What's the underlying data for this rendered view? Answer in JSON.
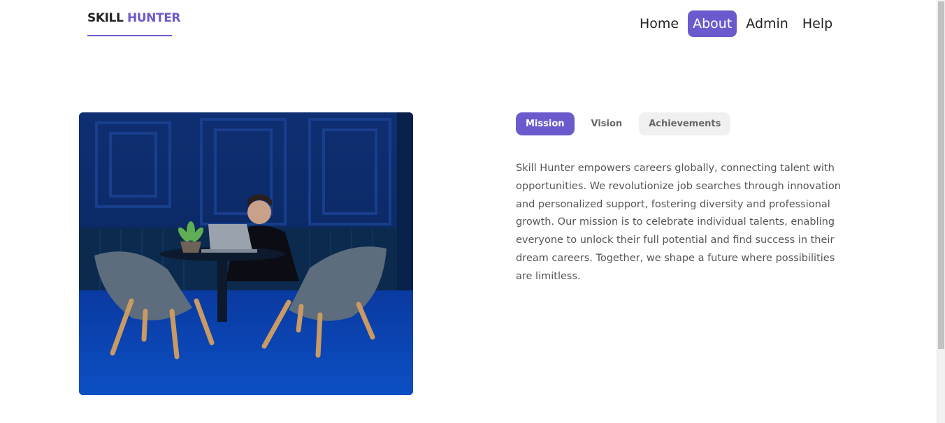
{
  "logo": {
    "skill": "SKILL",
    "hunter": "HUNTER"
  },
  "nav": {
    "items": [
      {
        "label": "Home"
      },
      {
        "label": "About"
      },
      {
        "label": "Admin"
      },
      {
        "label": "Help"
      }
    ],
    "active": "About"
  },
  "tabs": {
    "items": [
      {
        "label": "Mission"
      },
      {
        "label": "Vision"
      },
      {
        "label": "Achievements"
      }
    ],
    "active": "Mission"
  },
  "content": {
    "text": "Skill Hunter empowers careers globally, connecting talent with opportunities. We revolutionize job searches through innovation and personalized support, fostering diversity and professional growth. Our mission is to celebrate individual talents, enabling everyone to unlock their full potential and find success in their dream careers. Together, we shape a future where possibilities are limitless."
  },
  "colors": {
    "accent": "#6a5acd",
    "heroBlue": "#0c2c6a"
  }
}
